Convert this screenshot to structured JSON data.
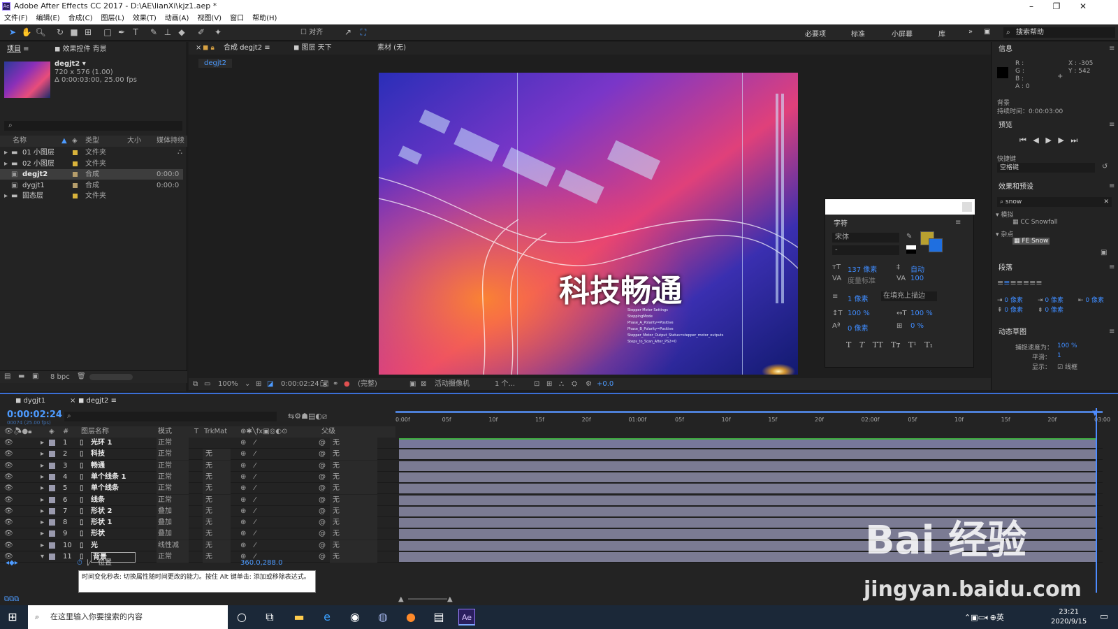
{
  "app": {
    "title": "Adobe After Effects CC 2017 - D:\\AE\\lianXi\\kjz1.aep *",
    "logo": "Ae"
  },
  "window_controls": [
    "–",
    "❐",
    "✕"
  ],
  "menu": [
    "文件(F)",
    "编辑(E)",
    "合成(C)",
    "图层(L)",
    "效果(T)",
    "动画(A)",
    "视图(V)",
    "窗口",
    "帮助(H)"
  ],
  "toolbar": {
    "snap_label": "对齐",
    "workspaces": [
      "必要项",
      "标准",
      "小屏幕",
      "库"
    ],
    "search_placeholder": "搜索帮助"
  },
  "project": {
    "tabs": [
      "项目",
      "效果控件 背景"
    ],
    "comp_name": "degjt2 ▾",
    "comp_info1": "720 x 576 (1.00)",
    "comp_info2": "Δ 0:00:03:00, 25.00 fps",
    "columns": [
      "名称",
      "类型",
      "大小",
      "媒体持续"
    ],
    "items": [
      {
        "name": "01 小图层",
        "type": "文件夹",
        "dur": "",
        "color": "#d9b33b",
        "selected": false
      },
      {
        "name": "02 小图层",
        "type": "文件夹",
        "dur": "",
        "color": "#d9b33b",
        "selected": false
      },
      {
        "name": "degjt2",
        "type": "合成",
        "dur": "0:00:0",
        "color": "#b59d6b",
        "selected": true
      },
      {
        "name": "dygjt1",
        "type": "合成",
        "dur": "0:00:0",
        "color": "#b59d6b",
        "selected": false
      },
      {
        "name": "固态层",
        "type": "文件夹",
        "dur": "",
        "color": "#d9b33b",
        "selected": false
      }
    ],
    "bpc": "8 bpc"
  },
  "composition": {
    "tabs": [
      "合成 degjt2",
      "图层 天下",
      "素材 (无)"
    ],
    "subtab": "degjt2",
    "overlay_title": "科技畅通",
    "small_text": [
      "Stepper Motor Settings",
      "SteppingMode",
      "Phase_A_Polarity=Positive",
      "Phase_B_Polarity=Positive",
      "Stepper_Motor_Output_Status=stepper_motor_outputs",
      "Steps_to_Scan_After_PS2=0"
    ],
    "footer": {
      "zoom": "100%",
      "time": "0:00:02:24",
      "quality": "(完整)",
      "camera": "活动摄像机",
      "views": "1 个...",
      "exposure": "+0.0"
    }
  },
  "character": {
    "title": "字符",
    "font": "宋体",
    "style": "-",
    "size": "137 像素",
    "leading": "自动",
    "kerning": "度量标准",
    "tracking": "100",
    "stroke": "1 像素",
    "stroke_mode": "在填充上描边",
    "vscale": "100 %",
    "hscale": "100 %",
    "baseline": "0 像素",
    "tsume": "0 %",
    "styles": [
      "T",
      "T",
      "TT",
      "Tт",
      "T¹",
      "T₁"
    ],
    "fill_color": "#b8a030",
    "stroke_color": "#1f6fe0"
  },
  "info": {
    "title": "信息",
    "rgba": [
      "R :",
      "G :",
      "B :",
      "A : 0"
    ],
    "x": "X : -305",
    "y": "Y : 542",
    "layer": "背景",
    "duration": "持续时间：0:00:03:00"
  },
  "preview": {
    "title": "预览",
    "shortcut_label": "快捷键",
    "shortcut_value": "空格键"
  },
  "effects": {
    "title": "效果和预设",
    "search": "snow",
    "groups": [
      {
        "name": "模拟",
        "item": "CC Snowfall"
      },
      {
        "name": "杂点",
        "item": "FE Snow"
      }
    ]
  },
  "paragraph": {
    "title": "段落",
    "indent": [
      "0 像素",
      "0 像素",
      "0 像素"
    ],
    "space": [
      "0 像素",
      "0 像素"
    ]
  },
  "motion_sketch": {
    "title": "动态草图",
    "capture_label": "捕捉速度为：",
    "capture_value": "100 %",
    "smooth_label": "平滑：",
    "smooth_value": "1",
    "show_label": "显示：",
    "show_value": "线框"
  },
  "timeline": {
    "tabs": [
      "dygjt1",
      "degjt2"
    ],
    "current_time": "0:00:02:24",
    "frame_info": "00074 (25.00 fps)",
    "ruler": [
      "0:00f",
      "05f",
      "10f",
      "15f",
      "20f",
      "01:00f",
      "05f",
      "10f",
      "15f",
      "20f",
      "02:00f",
      "05f",
      "10f",
      "15f",
      "20f",
      "03:00"
    ],
    "headers": {
      "num": "#",
      "name": "图层名称",
      "mode": "模式",
      "t": "T",
      "trkmat": "TrkMat",
      "parent": "父级"
    },
    "layers": [
      {
        "n": "1",
        "name": "光环 1",
        "mode": "正常",
        "trk": "",
        "parent": "无"
      },
      {
        "n": "2",
        "name": "科技",
        "mode": "正常",
        "trk": "无",
        "parent": "无"
      },
      {
        "n": "3",
        "name": "畅通",
        "mode": "正常",
        "trk": "无",
        "parent": "无"
      },
      {
        "n": "4",
        "name": "单个线条 1",
        "mode": "正常",
        "trk": "无",
        "parent": "无"
      },
      {
        "n": "5",
        "name": "单个线条",
        "mode": "正常",
        "trk": "无",
        "parent": "无"
      },
      {
        "n": "6",
        "name": "线条",
        "mode": "正常",
        "trk": "无",
        "parent": "无"
      },
      {
        "n": "7",
        "name": "形状 2",
        "mode": "叠加",
        "trk": "无",
        "parent": "无"
      },
      {
        "n": "8",
        "name": "形状 1",
        "mode": "叠加",
        "trk": "无",
        "parent": "无"
      },
      {
        "n": "9",
        "name": "形状",
        "mode": "叠加",
        "trk": "无",
        "parent": "无"
      },
      {
        "n": "10",
        "name": "光",
        "mode": "线性减",
        "trk": "无",
        "parent": "无"
      },
      {
        "n": "11",
        "name": "背景",
        "mode": "正常",
        "trk": "无",
        "parent": "无"
      }
    ],
    "property": {
      "name": "位置",
      "value": "360.0,288.0"
    },
    "tooltip": "时间变化秒表: 切换属性随时间更改的能力。按住 Alt 键单击: 添加或移除表达式。"
  },
  "taskbar": {
    "search_placeholder": "在这里输入你要搜索的内容",
    "time": "23:21",
    "date": "2020/9/15",
    "ime": "英"
  },
  "watermark": {
    "brand": "Bai 经验",
    "url": "jingyan.baidu.com"
  }
}
